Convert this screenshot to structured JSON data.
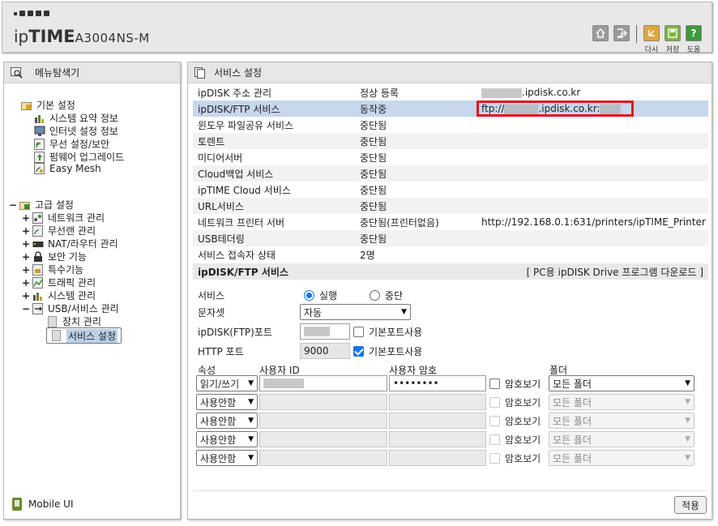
{
  "header": {
    "brand_ip": "ip",
    "brand_time": "TIME",
    "model": "A3004NS-M",
    "buttons": [
      {
        "label": "",
        "icon": "home-icon"
      },
      {
        "label": "",
        "icon": "logout-icon"
      },
      {
        "label": "다시",
        "icon": "refresh-icon"
      },
      {
        "label": "저장",
        "icon": "save-icon"
      },
      {
        "label": "도움",
        "icon": "help-icon"
      }
    ]
  },
  "sidebar": {
    "title": "메뉴탐색기",
    "basic": {
      "label": "기본 설정",
      "items": [
        "시스템 요약 정보",
        "인터넷 설정 정보",
        "무선 설정/보안",
        "펌웨어 업그레이드",
        "Easy Mesh"
      ]
    },
    "advanced": {
      "label": "고급 설정",
      "items": [
        "네트워크 관리",
        "무선랜 관리",
        "NAT/라우터 관리",
        "보안 기능",
        "특수기능",
        "트래픽 관리",
        "시스템 관리",
        "USB/서비스 관리"
      ],
      "usb_children": [
        "장치 관리",
        "서비스 설정"
      ]
    },
    "mobile_ui": "Mobile UI"
  },
  "main": {
    "title": "서비스 설정",
    "services": [
      {
        "name": "ipDISK 주소 관리",
        "status": "정상 등록",
        "detail_suffix": ".ipdisk.co.kr"
      },
      {
        "name": "ipDISK/FTP 서비스",
        "status": "동작중",
        "detail_prefix": "ftp://",
        "detail_suffix": ".ipdisk.co.kr:"
      },
      {
        "name": "윈도우 파일공유 서비스",
        "status": "중단됨",
        "detail": ""
      },
      {
        "name": "토렌트",
        "status": "중단됨",
        "detail": ""
      },
      {
        "name": "미디어서버",
        "status": "중단됨",
        "detail": ""
      },
      {
        "name": "Cloud백업 서비스",
        "status": "중단됨",
        "detail": ""
      },
      {
        "name": "ipTIME Cloud 서비스",
        "status": "중단됨",
        "detail": ""
      },
      {
        "name": "URL서비스",
        "status": "중단됨",
        "detail": ""
      },
      {
        "name": "네트워크 프린터 서버",
        "status": "중단됨(프린터없음)",
        "detail": "http://192.168.0.1:631/printers/ipTIME_Printer"
      },
      {
        "name": "USB테더링",
        "status": "중단됨",
        "detail": ""
      },
      {
        "name": "서비스 접속자 상태",
        "status": "2명",
        "detail": ""
      }
    ],
    "ftp_section": {
      "title": "ipDISK/FTP 서비스",
      "download_link": "[ PC용 ipDISK Drive 프로그램 다운로드 ]",
      "service_label": "서비스",
      "run_label": "실행",
      "stop_label": "중단",
      "charset_label": "문자셋",
      "charset_value": "자동",
      "ftp_port_label": "ipDISK(FTP)포트",
      "default_port_label": "기본포트사용",
      "http_port_label": "HTTP 포트",
      "http_port_value": "9000",
      "col_attr": "속성",
      "col_user": "사용자 ID",
      "col_pass": "사용자 암호",
      "col_folder": "폴더",
      "show_pass": "암호보기",
      "users": [
        {
          "attr": "읽기/쓰기",
          "pass": "••••••••",
          "folder": "모든 폴더"
        },
        {
          "attr": "사용안함",
          "pass": "",
          "folder": "모든 폴더"
        },
        {
          "attr": "사용안함",
          "pass": "",
          "folder": "모든 폴더"
        },
        {
          "attr": "사용안함",
          "pass": "",
          "folder": "모든 폴더"
        },
        {
          "attr": "사용안함",
          "pass": "",
          "folder": "모든 폴더"
        }
      ],
      "apply": "적용"
    }
  }
}
